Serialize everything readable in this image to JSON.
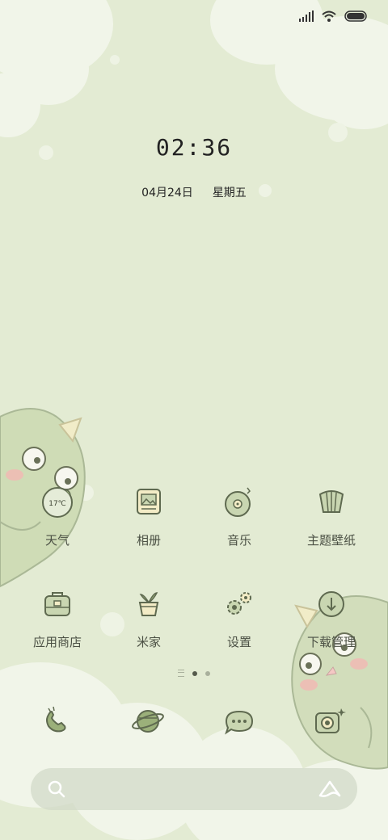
{
  "status_bar": {
    "icons": [
      "signal-icon",
      "wifi-icon",
      "battery-icon"
    ]
  },
  "clock": {
    "time": "02:36",
    "date": "04月24日",
    "weekday": "星期五"
  },
  "apps": [
    {
      "label": "天气",
      "icon": "weather-icon",
      "badge": "17℃"
    },
    {
      "label": "相册",
      "icon": "gallery-icon"
    },
    {
      "label": "音乐",
      "icon": "music-icon"
    },
    {
      "label": "主题壁纸",
      "icon": "themes-icon"
    },
    {
      "label": "应用商店",
      "icon": "app-store-icon"
    },
    {
      "label": "米家",
      "icon": "mijia-icon"
    },
    {
      "label": "设置",
      "icon": "settings-icon"
    },
    {
      "label": "下载管理",
      "icon": "download-icon"
    }
  ],
  "page_indicator": {
    "pages": 2,
    "active": 1
  },
  "dock": [
    {
      "icon": "phone-icon"
    },
    {
      "icon": "browser-icon"
    },
    {
      "icon": "messages-icon"
    },
    {
      "icon": "camera-icon"
    }
  ],
  "search_bar": {
    "left_icon": "search-icon",
    "right_icon": "assistant-icon"
  },
  "colors": {
    "background": "#e3ebd3",
    "icon_stroke": "#5f6a50",
    "icon_fill": "#c9d6b1"
  }
}
